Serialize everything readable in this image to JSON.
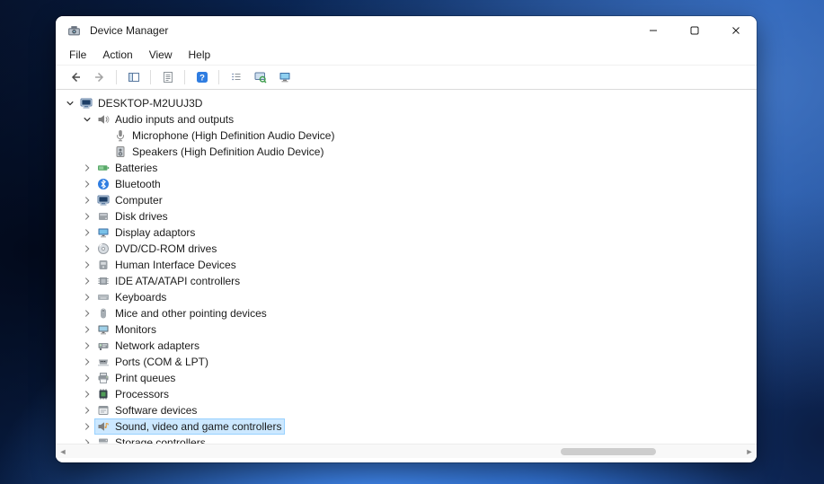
{
  "window": {
    "title": "Device Manager",
    "controls": [
      {
        "name": "minimize"
      },
      {
        "name": "maximize"
      },
      {
        "name": "close"
      }
    ]
  },
  "menu": {
    "items": [
      {
        "label": "File"
      },
      {
        "label": "Action"
      },
      {
        "label": "View"
      },
      {
        "label": "Help"
      }
    ]
  },
  "toolbar": {
    "items": [
      {
        "name": "back"
      },
      {
        "name": "forward"
      },
      {
        "sep": true
      },
      {
        "name": "console-tree"
      },
      {
        "sep": true
      },
      {
        "name": "properties"
      },
      {
        "sep": true
      },
      {
        "name": "help"
      },
      {
        "sep": true
      },
      {
        "name": "export-list"
      },
      {
        "name": "scan-hardware-changes"
      },
      {
        "name": "devices-view"
      }
    ]
  },
  "tree": {
    "items": [
      {
        "level": 0,
        "expander": "down",
        "icon": "computer",
        "label": "DESKTOP-M2UUJ3D"
      },
      {
        "level": 1,
        "expander": "down",
        "icon": "audio",
        "label": "Audio inputs and outputs"
      },
      {
        "level": 2,
        "expander": "none",
        "icon": "microphone",
        "label": "Microphone (High Definition Audio Device)"
      },
      {
        "level": 2,
        "expander": "none",
        "icon": "speakers",
        "label": "Speakers (High Definition Audio Device)"
      },
      {
        "level": 1,
        "expander": "right",
        "icon": "battery",
        "label": "Batteries"
      },
      {
        "level": 1,
        "expander": "right",
        "icon": "bluetooth",
        "label": "Bluetooth"
      },
      {
        "level": 1,
        "expander": "right",
        "icon": "computer",
        "label": "Computer"
      },
      {
        "level": 1,
        "expander": "right",
        "icon": "disk",
        "label": "Disk drives"
      },
      {
        "level": 1,
        "expander": "right",
        "icon": "display",
        "label": "Display adaptors"
      },
      {
        "level": 1,
        "expander": "right",
        "icon": "dvd",
        "label": "DVD/CD-ROM drives"
      },
      {
        "level": 1,
        "expander": "right",
        "icon": "hid",
        "label": "Human Interface Devices"
      },
      {
        "level": 1,
        "expander": "right",
        "icon": "ide",
        "label": "IDE ATA/ATAPI controllers"
      },
      {
        "level": 1,
        "expander": "right",
        "icon": "keyboard",
        "label": "Keyboards"
      },
      {
        "level": 1,
        "expander": "right",
        "icon": "mouse",
        "label": "Mice and other pointing devices"
      },
      {
        "level": 1,
        "expander": "right",
        "icon": "monitor",
        "label": "Monitors"
      },
      {
        "level": 1,
        "expander": "right",
        "icon": "network",
        "label": "Network adapters"
      },
      {
        "level": 1,
        "expander": "right",
        "icon": "ports",
        "label": "Ports (COM & LPT)"
      },
      {
        "level": 1,
        "expander": "right",
        "icon": "printer",
        "label": "Print queues"
      },
      {
        "level": 1,
        "expander": "right",
        "icon": "processor",
        "label": "Processors"
      },
      {
        "level": 1,
        "expander": "right",
        "icon": "software",
        "label": "Software devices"
      },
      {
        "level": 1,
        "expander": "right",
        "icon": "sound",
        "label": "Sound, video and game controllers",
        "selected": true
      },
      {
        "level": 1,
        "expander": "right",
        "icon": "storage",
        "label": "Storage controllers"
      }
    ]
  }
}
